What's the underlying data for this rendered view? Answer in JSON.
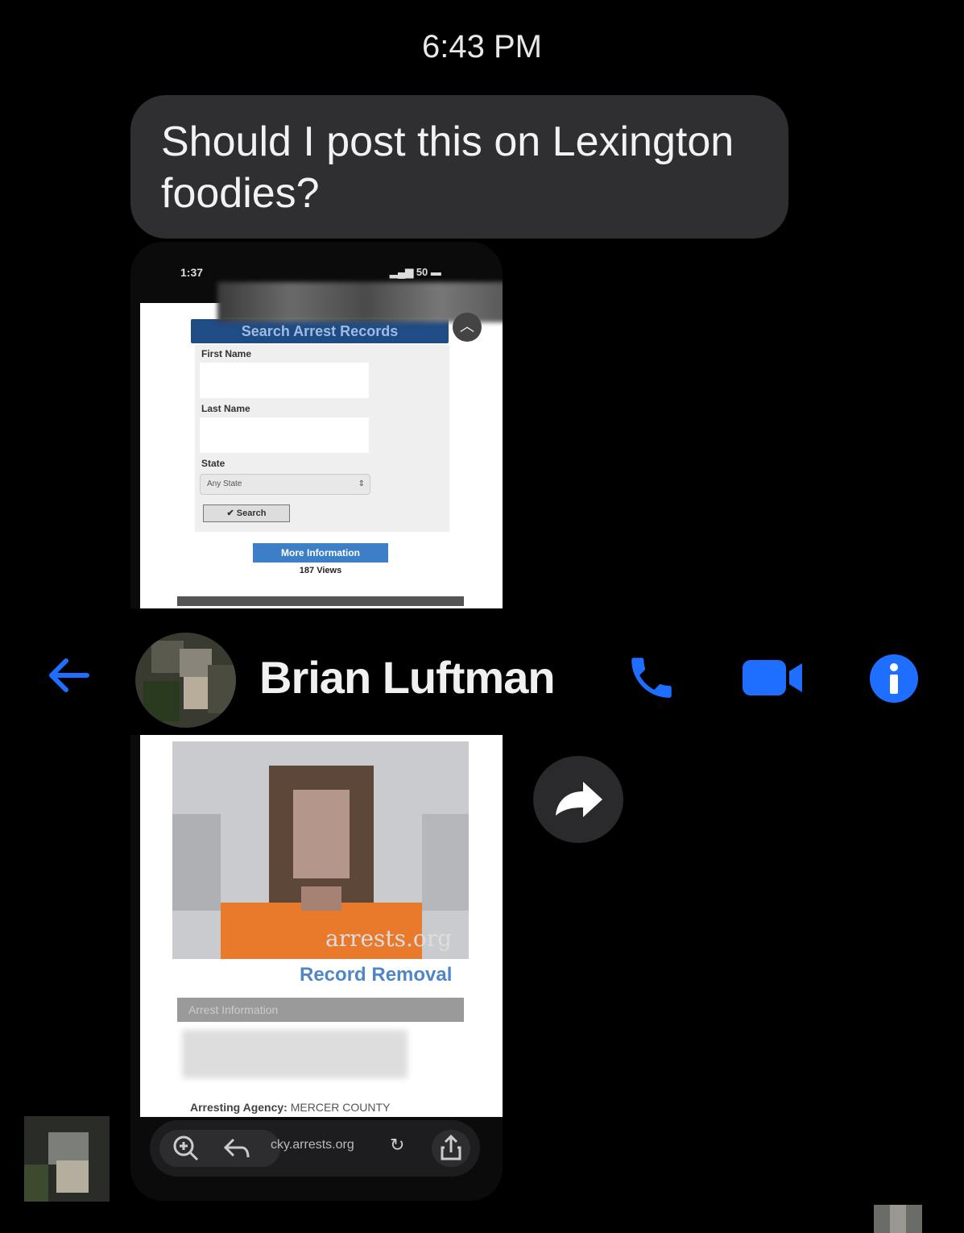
{
  "timestamp": "6:43 PM",
  "message": {
    "text": "Should I post this on Lexington foodies?"
  },
  "attachment_top": {
    "status_time": "1:37",
    "status_right": "50",
    "form_title": "Search Arrest Records",
    "first_name_label": "First Name",
    "last_name_label": "Last Name",
    "state_label": "State",
    "state_value": "Any State",
    "search_button": "Search",
    "more_info_button": "More Information",
    "views": "187 Views"
  },
  "header": {
    "contact_name": "Brian Luftman",
    "accent_color": "#1e6fff"
  },
  "attachment_bottom": {
    "watermark": "arrests.org",
    "record_removal": "Record Removal",
    "arrest_info_heading": "Arrest Information",
    "agency_label": "Arresting Agency:",
    "agency_value": "MERCER COUNTY",
    "url": "cky.arrests.org"
  }
}
